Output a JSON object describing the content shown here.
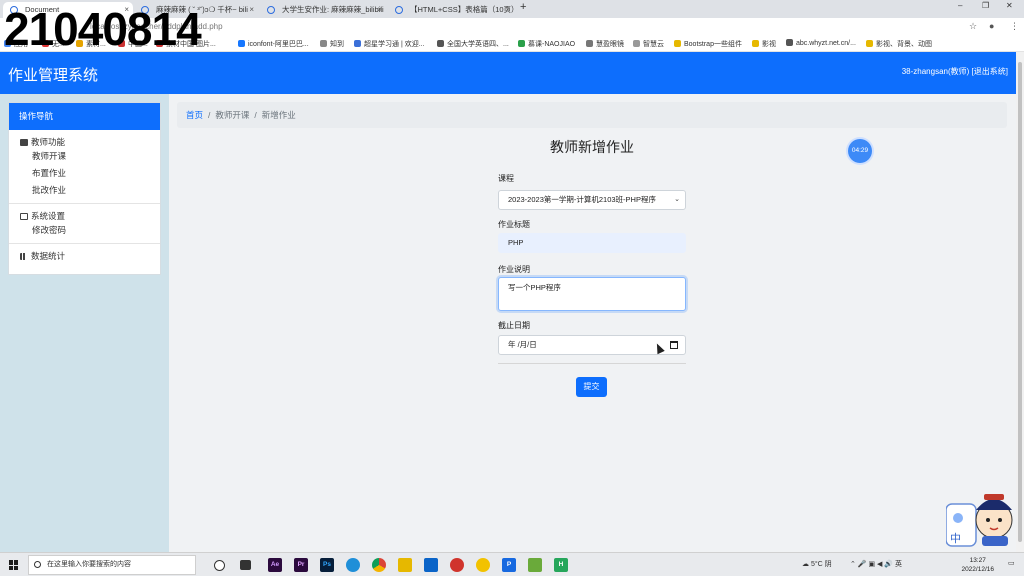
{
  "overlay_number": "21040814",
  "browser": {
    "tabs": [
      {
        "label": "Document",
        "close": "×"
      },
      {
        "label": "麻辣麻辣 ( ˘ ³˘)ɔ❍ 千杯~ bili",
        "close": "×"
      },
      {
        "label": "大学生安作业: 麻辣麻辣_bilibili",
        "close": "×"
      },
      {
        "label": "【HTML+CSS】表格篇（10页）",
        "close": "×"
      }
    ],
    "new_tab": "+",
    "window_controls": [
      "–",
      "❐",
      "✕"
    ],
    "url": "localhost/zy/teacher/addplan/add.php",
    "bookmarks": [
      "应用",
      "无...",
      "素材...",
      "中国...",
      "素材中国 图片...",
      "iconfont-阿里巴巴...",
      "知到",
      "超星学习通 | 欢迎...",
      "全国大学英语四、...",
      "慕课-NAOJIAO",
      "慧盈眼镜",
      "智慧云",
      "Bootstrap一些组件",
      "影视",
      "abc.whyzt.net.cn/...",
      "影视、背景、动图"
    ]
  },
  "app": {
    "title": "作业管理系统",
    "user_text": "38-zhangsan(教师)",
    "logout": "[退出系统]"
  },
  "sidebar": {
    "header": "操作导航",
    "groups": [
      {
        "title": "教师功能",
        "icon": "book-icon",
        "items": [
          "教师开课",
          "布置作业",
          "批改作业"
        ]
      },
      {
        "title": "系统设置",
        "icon": "card-icon",
        "items": [
          "修改密码"
        ]
      },
      {
        "title": "数据统计",
        "icon": "bar-chart-icon",
        "items": []
      }
    ]
  },
  "breadcrumb": {
    "home": "首页",
    "sep": "/",
    "level2": "教师开课",
    "current": "新增作业"
  },
  "page_title": "教师新增作业",
  "timer": "04:29",
  "form": {
    "course_label": "课程",
    "course_value": "2023-2023第一学期-计算机2103班-PHP程序",
    "title_label": "作业标题",
    "title_value": "PHP",
    "desc_label": "作业说明",
    "desc_value": "写一个PHP程序",
    "deadline_label": "截止日期",
    "deadline_placeholder": "年 /月/日",
    "submit": "提交"
  },
  "taskbar": {
    "search_placeholder": "在这里输入你要搜索的内容",
    "weather": "5°C 阴",
    "ime": "英",
    "time": "13:27",
    "date": "2022/12/16"
  },
  "colors": {
    "primary": "#0d6efd",
    "sidebar_bg": "#cfe2ea"
  }
}
